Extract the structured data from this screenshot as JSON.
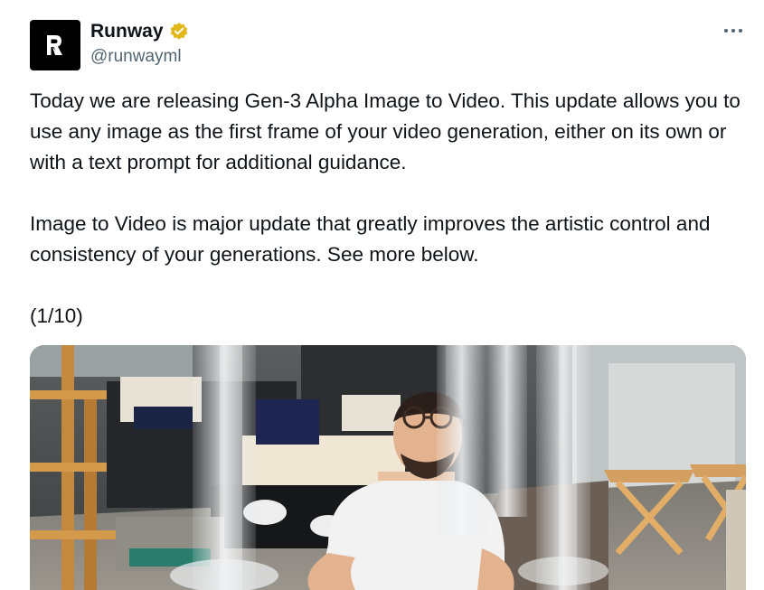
{
  "author": {
    "display_name": "Runway",
    "handle": "@runwayml",
    "avatar_icon": "runway-logo-icon",
    "verified_icon": "verified-badge-icon",
    "verified_color": "#e2b719"
  },
  "menu": {
    "icon": "more-options-icon"
  },
  "tweet": {
    "paragraph_1": "Today we are releasing Gen-3 Alpha Image to Video. This update allows you to use any image as the first frame of your video generation, either on its own or with a text prompt for additional guidance.",
    "paragraph_2": "Image to Video is major update that greatly improves the artistic control and consistency of your generations. See more below.",
    "paragraph_3": "(1/10)"
  },
  "media": {
    "type": "video-frame"
  }
}
